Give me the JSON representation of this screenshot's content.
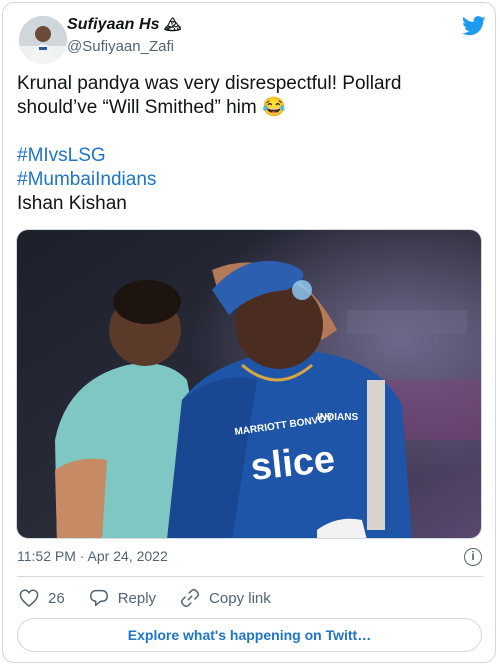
{
  "author": {
    "name": "Sufiyaan Hs",
    "name_emoji": "🏔",
    "handle": "@Sufiyaan_Zafi"
  },
  "tweet": {
    "line1": "Krunal pandya was very disrespectful! Pollard",
    "line2": "should’ve “Will Smithed” him 😂",
    "hashtag1": "#MIvsLSG",
    "hashtag2": "#MumbaiIndians",
    "line3": "Ishan Kishan"
  },
  "photo": {
    "jersey_text": "slice",
    "jersey_sponsor": "MARRIOTT BONVOY",
    "jersey_team": "INDIANS"
  },
  "meta": {
    "timestamp": "11:52 PM · Apr 24, 2022",
    "info_glyph": "i"
  },
  "actions": {
    "likes": "26",
    "reply_label": "Reply",
    "copy_label": "Copy link"
  },
  "explore_label": "Explore what's happening on Twitt…",
  "colors": {
    "link": "#1d74c8",
    "border": "#cfd9de",
    "muted": "#536471",
    "twitter_blue": "#1d9bf0"
  },
  "icons": [
    "twitter-bird-icon",
    "heart-icon",
    "reply-icon",
    "link-icon",
    "info-icon"
  ]
}
